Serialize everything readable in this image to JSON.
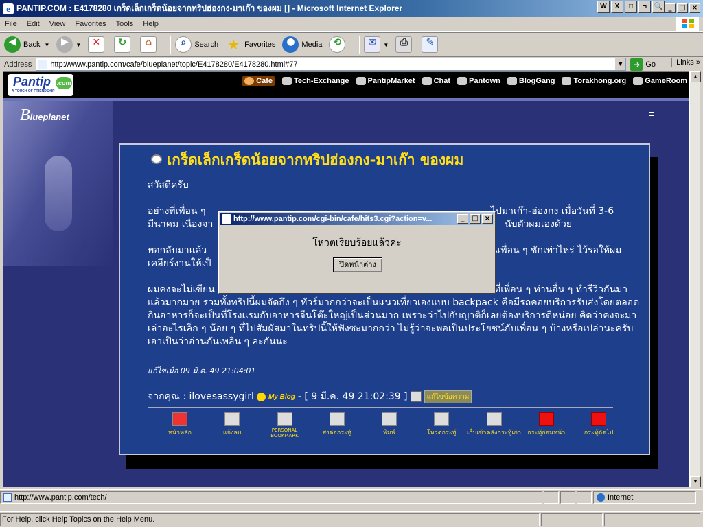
{
  "window": {
    "title": "PANTIP.COM : E4178280 เกร็ดเล็กเกร็ดน้อยจากทริปฮ่องกง-มาเก๊า ของผม [] - Microsoft Internet Explorer",
    "tray_icons": [
      "W",
      "X",
      "□",
      "¬",
      "🔍"
    ]
  },
  "menu": [
    "File",
    "Edit",
    "View",
    "Favorites",
    "Tools",
    "Help"
  ],
  "toolbar": {
    "back": "Back",
    "search": "Search",
    "favorites": "Favorites",
    "media": "Media"
  },
  "address": {
    "label": "Address",
    "url": "http://www.pantip.com/cafe/blueplanet/topic/E4178280/E4178280.html#77",
    "go": "Go",
    "links": "Links"
  },
  "pantip": {
    "logo": "Pantip",
    "logo_badge": ".com",
    "tagline": "A TOUCH OF FRIENDSHIP",
    "nav": [
      "Cafe",
      "Tech-Exchange",
      "PantipMarket",
      "Chat",
      "Pantown",
      "BlogGang",
      "Torakhong.org",
      "GameRoom"
    ]
  },
  "room": {
    "initial": "B",
    "name": "lueplanet"
  },
  "post": {
    "title": "เกร็ดเล็กเกร็ดน้อยจากทริปฮ่องกง-มาเก๊า ของผม",
    "greeting": "สวัสดีครับ",
    "para1a": "อย่างที่เพื่อน ๆ",
    "para1b": "ไปมาเก๊า-ฮ่องกง เมื่อวันที่ 3-6",
    "para1c": "มีนาคม เนื่องจา",
    "para1d": "นับตัวผมเองด้วย",
    "para2a": "พอกลับมาแล้ว",
    "para2b": "นเพื่อน ๆ ซักเท่าไหร่ ไว้รอให้ผม",
    "para2c": "เคลียร์งานให้เป็",
    "para3a": "ผมคงจะไม่เขียน",
    "para3b": "ที่เพื่อน ๆ ท่านอื่น ๆ ทำรีวิวกันมา",
    "para3rest": "แล้วมากมาย รวมทั้งทริปนี้ผมจัดกึ่ง ๆ ทัวร์มากกว่าจะเป็นแนวเที่ยวเองแบบ backpack คือมีรถคอยบริการรับส่งโดยตลอด กินอาหารก็จะเป็นที่โรงแรมกับอาหารจีนโต๊ะใหญ่เป็นส่วนมาก เพราะว่าไปกับญาติก็เลยต้องบริการดีหน่อย คิดว่าคงจะมาเล่าอะไรเล็ก ๆ น้อย ๆ ที่ไปสัมผัสมาในทริปนี้ให้ฟังซะมากกว่า ไม่รู้ว่าจะพอเป็นประโยชน์กับเพื่อน ๆ บ้างหรือเปล่านะครับ เอาเป็นว่าอ่านกันเพลิน ๆ ละกันนะ",
    "edited": "แก้ไขเมื่อ 09 มี.ค. 49 21:04:01",
    "from_label": "จากคุณ : ilovesassygirl",
    "myblog": "My Blog",
    "date": "- [ 9 มี.ค. 49 21:02:39 ]",
    "edit_button": "แก้ไขข้อความ"
  },
  "actions": [
    {
      "label": "หน้าหลัก",
      "icon": "home-icon"
    },
    {
      "label": "แจ้งลบ",
      "icon": "trash-icon"
    },
    {
      "label": "PERSONAL BOOKMARK",
      "icon": "book-icon"
    },
    {
      "label": "ส่งต่อกระทู้",
      "icon": "forward-icon"
    },
    {
      "label": "พิมพ์",
      "icon": "printer-icon"
    },
    {
      "label": "โหวตกระทู้",
      "icon": "hand-icon"
    },
    {
      "label": "เก็บเข้าคลังกระทู้เก่า",
      "icon": "archive-icon"
    },
    {
      "label": "กระทู้ก่อนหน้า",
      "icon": "arrow-left-icon"
    },
    {
      "label": "กระทู้ถัดไป",
      "icon": "arrow-right-icon"
    }
  ],
  "popup": {
    "title": "http://www.pantip.com/cgi-bin/cafe/hits3.cgi?action=v...",
    "message": "โหวตเรียบร้อยแล้วค่ะ",
    "button": "ปิดหน้าต่าง"
  },
  "status": {
    "url": "http://www.pantip.com/tech/",
    "zone": "Internet",
    "help": "For Help, click Help Topics on the Help Menu."
  }
}
